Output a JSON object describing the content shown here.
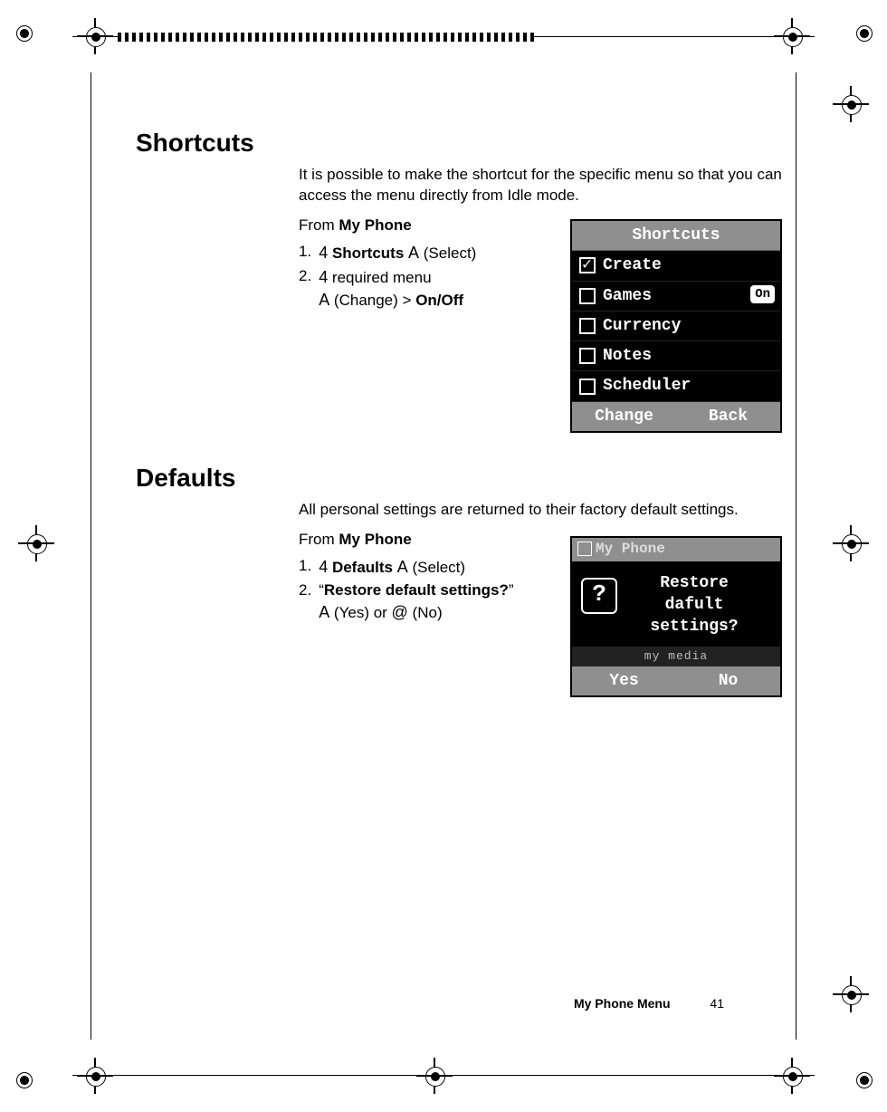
{
  "sections": {
    "shortcuts": {
      "heading": "Shortcuts",
      "intro": "It is possible to make the shortcut for the specific menu so that you can access the menu directly from Idle mode.",
      "from_prefix": "From ",
      "from_target": "My Phone",
      "steps": {
        "s1_num": "1.",
        "s1_sym": "4",
        "s1_bold": "Shortcuts",
        "s1_sym2": "A",
        "s1_tail": " (Select)",
        "s2_num": "2.",
        "s2_sym": "4",
        "s2_text": " required menu",
        "s2b_sym": "A",
        "s2b_text": " (Change) > ",
        "s2b_bold": "On/Off"
      }
    },
    "defaults": {
      "heading": "Defaults",
      "intro": "All personal settings are returned to their factory default settings.",
      "from_prefix": "From ",
      "from_target": "My Phone",
      "steps": {
        "s1_num": "1.",
        "s1_sym": "4",
        "s1_bold": "Defaults",
        "s1_sym2": "A",
        "s1_tail": " (Select)",
        "s2_num": "2.",
        "s2_quote_open": "“",
        "s2_bold": "Restore default settings?",
        "s2_quote_close": "”",
        "s2b_sym": "A",
        "s2b_text1": " (Yes) or ",
        "s2b_sym2": "@",
        "s2b_text2": " (No)"
      }
    }
  },
  "screenshot_shortcuts": {
    "title": "Shortcuts",
    "items": [
      {
        "icon": "check",
        "label": "Create",
        "badge": ""
      },
      {
        "icon": "box",
        "label": "Games",
        "badge": "On"
      },
      {
        "icon": "box",
        "label": "Currency",
        "badge": ""
      },
      {
        "icon": "box",
        "label": "Notes",
        "badge": ""
      },
      {
        "icon": "box",
        "label": "Scheduler",
        "badge": ""
      }
    ],
    "soft_left": "Change",
    "soft_right": "Back"
  },
  "screenshot_defaults": {
    "title": "My Phone",
    "dialog_line1": "Restore",
    "dialog_line2": "dafult",
    "dialog_line3": "settings?",
    "subbar": "my media",
    "soft_left": "Yes",
    "soft_right": "No"
  },
  "footer": {
    "title": "My Phone Menu",
    "page": "41"
  }
}
